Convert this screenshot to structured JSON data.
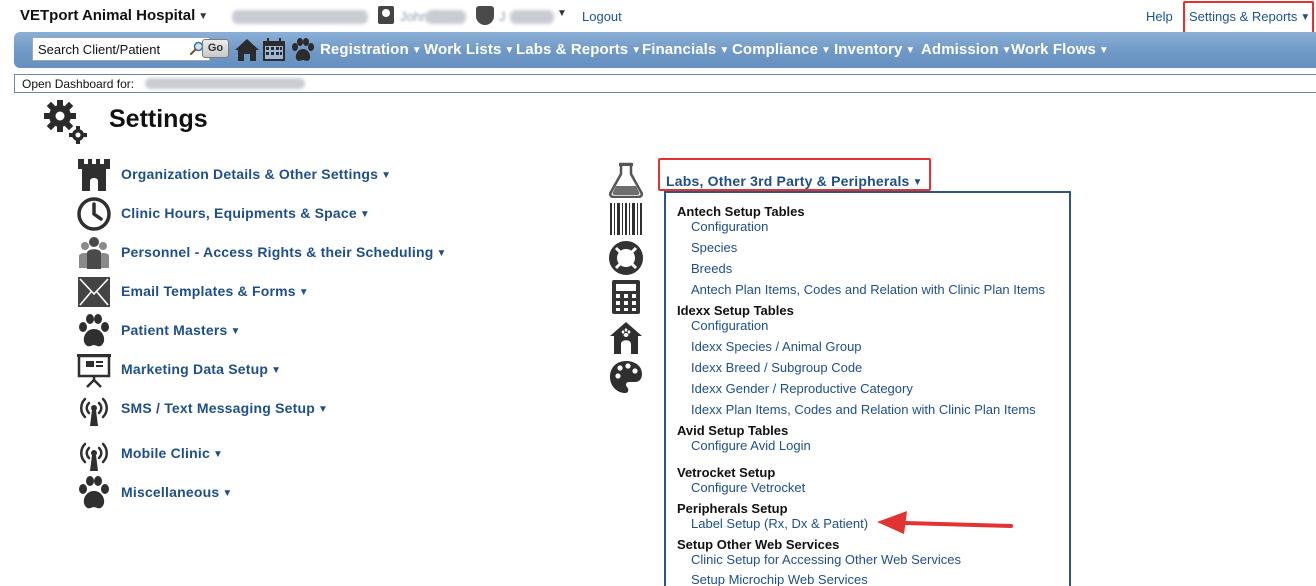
{
  "topbar": {
    "app_title": "VETport Animal Hospital",
    "user_name": "John Doe",
    "user_initial": "J",
    "logout": "Logout",
    "help": "Help",
    "settings_reports": "Settings & Reports"
  },
  "navbar": {
    "search_placeholder": "Search Client/Patient",
    "go": "Go",
    "menus": [
      "Registration",
      "Work Lists",
      "Labs & Reports",
      "Financials",
      "Compliance",
      "Inventory",
      "Admission",
      "Work Flows"
    ]
  },
  "dashboard": {
    "label": "Open Dashboard for:"
  },
  "page": {
    "title": "Settings"
  },
  "settings_items": [
    {
      "label": "Organization Details & Other Settings",
      "icon": "castle-icon"
    },
    {
      "label": "Clinic Hours, Equipments & Space",
      "icon": "clock-icon"
    },
    {
      "label": "Personnel - Access Rights & their Scheduling",
      "icon": "personnel-icon"
    },
    {
      "label": "Email Templates & Forms",
      "icon": "envelope-icon"
    },
    {
      "label": "Patient Masters",
      "icon": "paw-icon"
    },
    {
      "label": "Marketing Data Setup",
      "icon": "presentation-icon"
    },
    {
      "label": "SMS / Text Messaging Setup",
      "icon": "antenna-icon"
    },
    {
      "label": "Mobile Clinic",
      "icon": "antenna-icon"
    },
    {
      "label": "Miscellaneous",
      "icon": "paw-icon"
    }
  ],
  "labs_menu": {
    "header": "Labs, Other 3rd Party & Peripherals",
    "groups": [
      {
        "title": "Antech Setup Tables",
        "items": [
          "Configuration",
          "Species",
          "Breeds",
          "Antech Plan Items, Codes and Relation with Clinic Plan Items"
        ]
      },
      {
        "title": "Idexx Setup Tables",
        "items": [
          "Configuration",
          "Idexx Species / Animal Group",
          "Idexx Breed / Subgroup Code",
          "Idexx Gender / Reproductive Category",
          "Idexx Plan Items, Codes and Relation with Clinic Plan Items"
        ]
      },
      {
        "title": "Avid Setup Tables",
        "items": [
          "Configure Avid Login"
        ]
      },
      {
        "title": "Vetrocket Setup",
        "items": [
          "Configure Vetrocket"
        ]
      },
      {
        "title": "Peripherals Setup",
        "items": [
          "Label Setup (Rx, Dx & Patient)"
        ]
      },
      {
        "title": "Setup Other Web Services",
        "items": [
          "Clinic Setup for Accessing Other Web Services",
          "Setup Microchip Web Services"
        ]
      }
    ]
  },
  "colors": {
    "accent_red": "#e23232",
    "link_blue": "#1e4f88",
    "nav_blue": "#6f98c6"
  }
}
